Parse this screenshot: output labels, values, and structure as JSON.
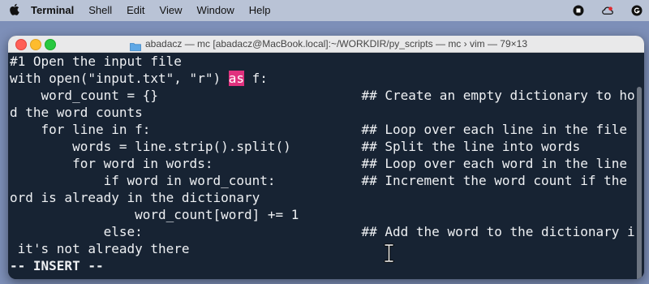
{
  "menubar": {
    "app_name": "Terminal",
    "items": [
      "Shell",
      "Edit",
      "View",
      "Window",
      "Help"
    ],
    "tray_icons": [
      "stop-record-icon",
      "creative-cloud-icon",
      "user-g-icon"
    ]
  },
  "window": {
    "title": "abadacz — mc [abadacz@MacBook.local]:~/WORKDIR/py_scripts — mc › vim — 79×13",
    "colors": {
      "background": "#172333",
      "foreground": "#eef0f3",
      "cursor": "#e0317e"
    }
  },
  "terminal": {
    "lines": [
      "#1 Open the input file",
      "with open(\"input.txt\", \"r\") ",
      "    word_count = {}                          ## Create an empty dictionary to hol",
      "d the word counts",
      "    for line in f:                           ## Loop over each line in the file",
      "        words = line.strip().split()         ## Split the line into words",
      "        for word in words:                   ## Loop over each word in the line",
      "            if word in word_count:           ## Increment the word count if the w",
      "ord is already in the dictionary",
      "                word_count[word] += 1",
      "            else:                            ## Add the word to the dictionary if",
      " it's not already there"
    ],
    "cursor_text": "as",
    "cursor_line_suffix": " f:",
    "mode": "-- INSERT --"
  }
}
